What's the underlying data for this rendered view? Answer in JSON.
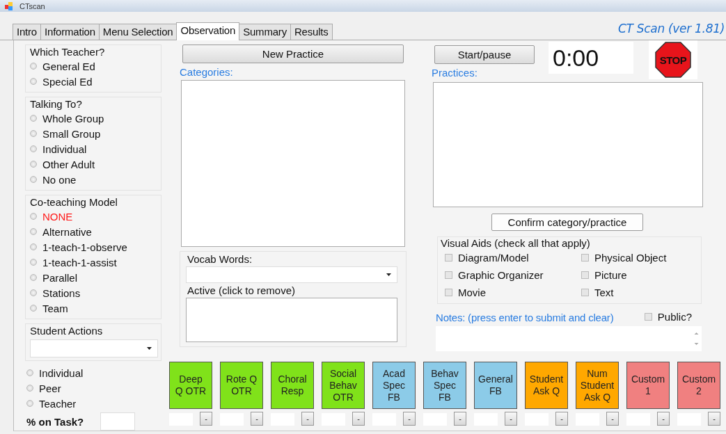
{
  "window": {
    "title": "CTscan"
  },
  "tabs": [
    {
      "label": "Intro",
      "selected": false
    },
    {
      "label": "Information",
      "selected": false
    },
    {
      "label": "Menu Selection",
      "selected": false
    },
    {
      "label": "Observation",
      "selected": true
    },
    {
      "label": "Summary",
      "selected": false
    },
    {
      "label": "Results",
      "selected": false
    }
  ],
  "version": "CT Scan (ver 1.81)",
  "left_panel": {
    "groups": [
      {
        "title": "Which Teacher?",
        "options": [
          {
            "label": "General Ed",
            "selected": false,
            "highlighted": false
          },
          {
            "label": "Special Ed",
            "selected": false,
            "highlighted": false
          }
        ]
      },
      {
        "title": "Talking To?",
        "options": [
          {
            "label": "Whole Group",
            "selected": false,
            "highlighted": false
          },
          {
            "label": "Small Group",
            "selected": false,
            "highlighted": false
          },
          {
            "label": "Individual",
            "selected": false,
            "highlighted": false
          },
          {
            "label": "Other Adult",
            "selected": false,
            "highlighted": false
          },
          {
            "label": "No one",
            "selected": false,
            "highlighted": false
          }
        ]
      },
      {
        "title": "Co-teaching Model",
        "options": [
          {
            "label": "NONE",
            "selected": false,
            "highlighted": true
          },
          {
            "label": "Alternative",
            "selected": false,
            "highlighted": false
          },
          {
            "label": "1-teach-1-observe",
            "selected": false,
            "highlighted": false
          },
          {
            "label": "1-teach-1-assist",
            "selected": false,
            "highlighted": false
          },
          {
            "label": "Parallel",
            "selected": false,
            "highlighted": false
          },
          {
            "label": "Stations",
            "selected": false,
            "highlighted": false
          },
          {
            "label": "Team",
            "selected": false,
            "highlighted": false
          }
        ]
      }
    ],
    "student_actions": {
      "title": "Student Actions",
      "options": [
        {
          "label": "Individual",
          "selected": false
        },
        {
          "label": "Peer",
          "selected": false
        },
        {
          "label": "Teacher",
          "selected": false
        }
      ],
      "on_task_label": "% on Task?"
    }
  },
  "middle_panel": {
    "new_practice_button": "New Practice",
    "categories_label": "Categories:",
    "vocab_label": "Vocab Words:",
    "active_label": "Active (click to remove)"
  },
  "right_panel": {
    "start_pause_button": "Start/pause",
    "timer": "0:00",
    "stop_sign": "STOP",
    "practices_label": "Practices:",
    "confirm_button": "Confirm category/practice",
    "visual_aids": {
      "title": "Visual Aids (check all that apply)",
      "items": [
        {
          "label": "Diagram/Model",
          "checked": false
        },
        {
          "label": "Physical Object",
          "checked": false
        },
        {
          "label": "Graphic Organizer",
          "checked": false
        },
        {
          "label": "Picture",
          "checked": false
        },
        {
          "label": "Movie",
          "checked": false
        },
        {
          "label": "Text",
          "checked": false
        }
      ]
    },
    "notes_label": "Notes: (press enter to submit and clear)",
    "public": {
      "label": "Public?",
      "checked": false
    }
  },
  "tiles": [
    {
      "label": "Deep\nQ OTR",
      "color": "#80e21a",
      "button": "-"
    },
    {
      "label": "Rote Q\nOTR",
      "color": "#80e21a",
      "button": "-"
    },
    {
      "label": "Choral\nResp",
      "color": "#80e21a",
      "button": "-"
    },
    {
      "label": "Social\nBehav\nOTR",
      "color": "#80e21a",
      "button": "-"
    },
    {
      "label": "Acad\nSpec\nFB",
      "color": "#8ccbe8",
      "button": "-"
    },
    {
      "label": "Behav\nSpec\nFB",
      "color": "#8ccbe8",
      "button": "-"
    },
    {
      "label": "General\nFB",
      "color": "#8ccbe8",
      "button": "-"
    },
    {
      "label": "Student\nAsk Q",
      "color": "#ffa800",
      "button": "-"
    },
    {
      "label": "Num\nStudent\nAsk Q",
      "color": "#ffa800",
      "button": "-"
    },
    {
      "label": "Custom\n1",
      "color": "#f08080",
      "button": "-"
    },
    {
      "label": "Custom\n2",
      "color": "#f08080",
      "button": "-"
    }
  ]
}
